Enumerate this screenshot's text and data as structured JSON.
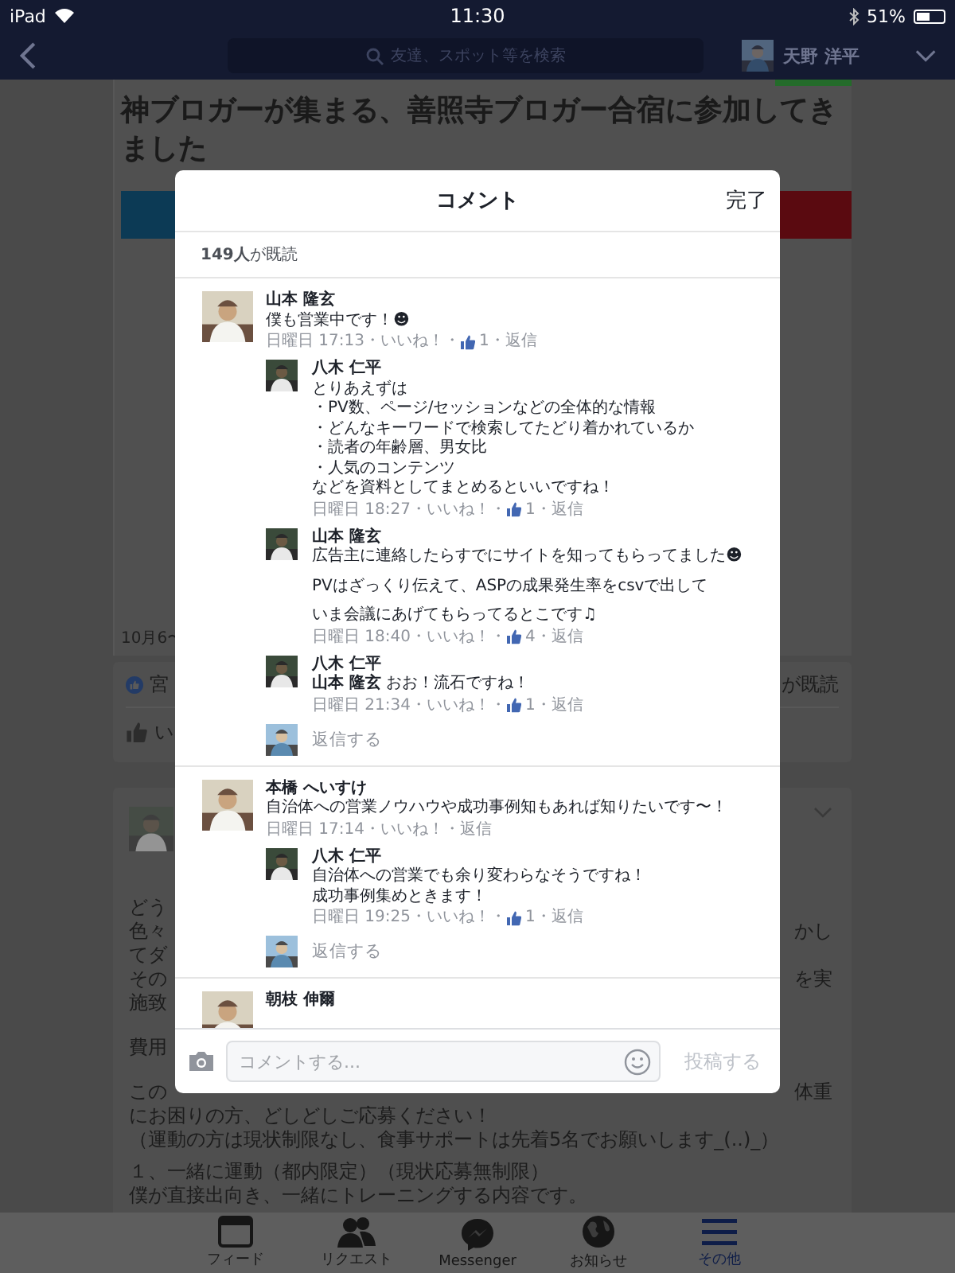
{
  "status_bar": {
    "device": "iPad",
    "time": "11:30",
    "battery": "51%"
  },
  "nav": {
    "search_placeholder": "友達、スポット等を検索",
    "user_name": "天野 洋平"
  },
  "post": {
    "title": "神ブロガーが集まる、善照寺ブロガー合宿に参加してきました",
    "date": "10月6〜",
    "likers": "宮",
    "seen": "が既読",
    "like_button": "い"
  },
  "post2": {
    "paragraphs": [
      [
        {
          "left": "どう"
        },
        {
          "left": "色々",
          "right": "かし"
        },
        {
          "left": "てダ"
        },
        {
          "left": "その",
          "right": "を実"
        },
        {
          "left": "施致"
        }
      ],
      [
        {
          "left": "費用"
        }
      ],
      [
        {
          "left": "この",
          "right": "体重"
        },
        {
          "left": "にお困りの方、どしどしご応募ください！"
        },
        {
          "left": "（運動の方は現状制限なし、食事サポートは先着5名でお願いします_(..)_）"
        }
      ],
      [
        {
          "left": "１、一緒に運動（都内限定）（現状応募無制限）"
        },
        {
          "left": "僕が直接出向き、一緒にトレーニングする内容です。"
        }
      ]
    ]
  },
  "modal": {
    "title": "コメント",
    "done": "完了",
    "seen": "**149人**が既読",
    "comments": [
      {
        "name": "山本 隆玄",
        "paragraphs": [
          [
            "僕も営業中です！☻"
          ]
        ],
        "meta": {
          "time": "日曜日 17:13・",
          "like": "いいね！・",
          "likes": "1・",
          "reply": "返信"
        },
        "children": [
          {
            "name": "八木 仁平",
            "paragraphs": [
              [
                "とりあえずは",
                "・PV数、ページ/セッションなどの全体的な情報",
                "・どんなキーワードで検索してたどり着かれているか",
                "・読者の年齢層、男女比",
                "・人気のコンテンツ",
                "などを資料としてまとめるといいですね！"
              ]
            ],
            "meta": {
              "time": "日曜日 18:27・",
              "like": "いいね！・",
              "likes": "1・",
              "reply": "返信"
            }
          },
          {
            "name": "山本 隆玄",
            "paragraphs": [
              [
                "広告主に連絡したらすでにサイトを知ってもらってました☻"
              ],
              [
                "PVはざっくり伝えて、ASPの成果発生率をcsvで出して"
              ],
              [
                "いま会議にあげてもらってるとこです♫"
              ]
            ],
            "meta": {
              "time": "日曜日 18:40・",
              "like": "いいね！・",
              "likes": "4・",
              "reply": "返信"
            }
          },
          {
            "name": "八木 仁平",
            "paragraphs": [
              [
                "**山本 隆玄** おお！流石ですね！"
              ]
            ],
            "meta": {
              "time": "日曜日 21:34・",
              "like": "いいね！・",
              "likes": "1・",
              "reply": "返信"
            }
          }
        ],
        "reply_prompt": "返信する"
      },
      {
        "name": "本橋 へいすけ",
        "paragraphs": [
          [
            "自治体への営業ノウハウや成功事例知もあれば知りたいです〜！"
          ]
        ],
        "meta": {
          "time": "日曜日 17:14・",
          "like": "いいね！・",
          "reply": "返信"
        },
        "children": [
          {
            "name": "八木 仁平",
            "paragraphs": [
              [
                "自治体への営業でも余り変わらなそうですね！",
                "成功事例集めときます！"
              ]
            ],
            "meta": {
              "time": "日曜日 19:25・",
              "like": "いいね！・",
              "likes": "1・",
              "reply": "返信"
            }
          }
        ],
        "reply_prompt": "返信する"
      },
      {
        "name": "朝枝 伸爾"
      }
    ],
    "composer": {
      "placeholder": "コメントする...",
      "submit": "投稿する",
      "disabled": true
    }
  },
  "tab_bar": [
    {
      "kind": "feed",
      "label": "フィード",
      "selected": false
    },
    {
      "kind": "requests",
      "label": "リクエスト",
      "selected": false
    },
    {
      "kind": "messenger",
      "label": "Messenger",
      "selected": false
    },
    {
      "kind": "globe",
      "label": "お知らせ",
      "selected": false
    },
    {
      "kind": "menu",
      "label": "その他",
      "selected": true
    }
  ]
}
